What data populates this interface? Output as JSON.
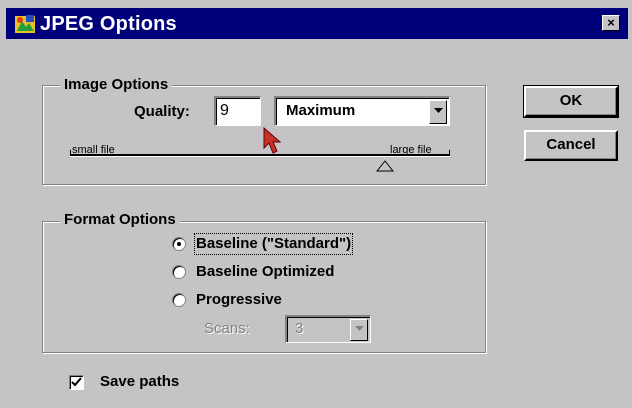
{
  "window": {
    "title": "JPEG Options",
    "close_glyph": "×",
    "title_bar_color": "#00007b",
    "face_color": "#c6c3c6"
  },
  "buttons": {
    "ok_label": "OK",
    "cancel_label": "Cancel"
  },
  "image_options": {
    "legend": "Image Options",
    "quality_label": "Quality:",
    "quality_value": "9",
    "quality_preset": "Maximum",
    "slider_min_label": "small file",
    "slider_max_label": "large file",
    "slider_position": 0.83
  },
  "format_options": {
    "legend": "Format Options",
    "options": [
      {
        "label": "Baseline (\"Standard\")",
        "selected": true
      },
      {
        "label": "Baseline Optimized",
        "selected": false
      },
      {
        "label": "Progressive",
        "selected": false
      }
    ],
    "scans_label": "Scans:",
    "scans_value": "3",
    "scans_enabled": false
  },
  "save_paths": {
    "label": "Save paths",
    "checked": true
  },
  "icons": {
    "app": "photoshop-app-icon",
    "close": "close-icon",
    "dropdown": "chevron-down-icon",
    "slider_thumb": "triangle-up-icon",
    "cursor": "mouse-pointer-icon"
  }
}
